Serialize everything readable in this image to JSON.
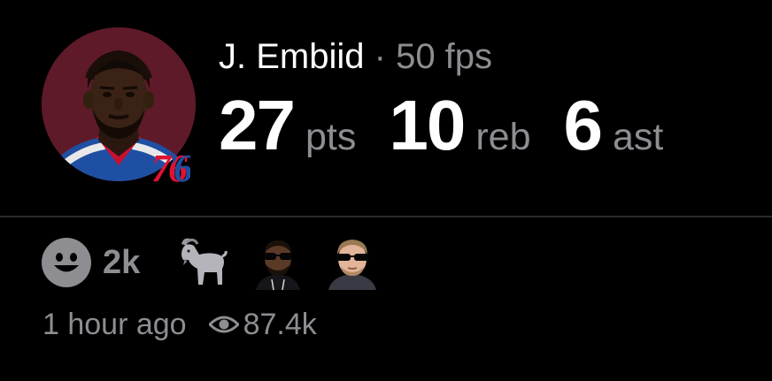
{
  "player": {
    "name": "J. Embiid",
    "separator": "·",
    "fantasy_points": "50 fps",
    "avatar": "player-headshot",
    "team_logo_text": "76",
    "team_logo_colors": {
      "red": "#e01234",
      "blue": "#1d4fa0",
      "bg": "#5e1a28"
    }
  },
  "stats": [
    {
      "value": "27",
      "label": "pts"
    },
    {
      "value": "10",
      "label": "reb"
    },
    {
      "value": "6",
      "label": "ast"
    }
  ],
  "reactions": {
    "primary_icon": "smiley-icon",
    "count": "2k",
    "emojis": [
      "goat-emoji",
      "sunglasses-face-emoji",
      "sunglasses-face-emoji-2"
    ]
  },
  "meta": {
    "time_ago": "1 hour ago",
    "views_icon": "eye-icon",
    "views": "87.4k"
  },
  "colors": {
    "background": "#000000",
    "primary_text": "#ffffff",
    "secondary_text": "#8d8d92",
    "divider": "#2a2a2c"
  }
}
